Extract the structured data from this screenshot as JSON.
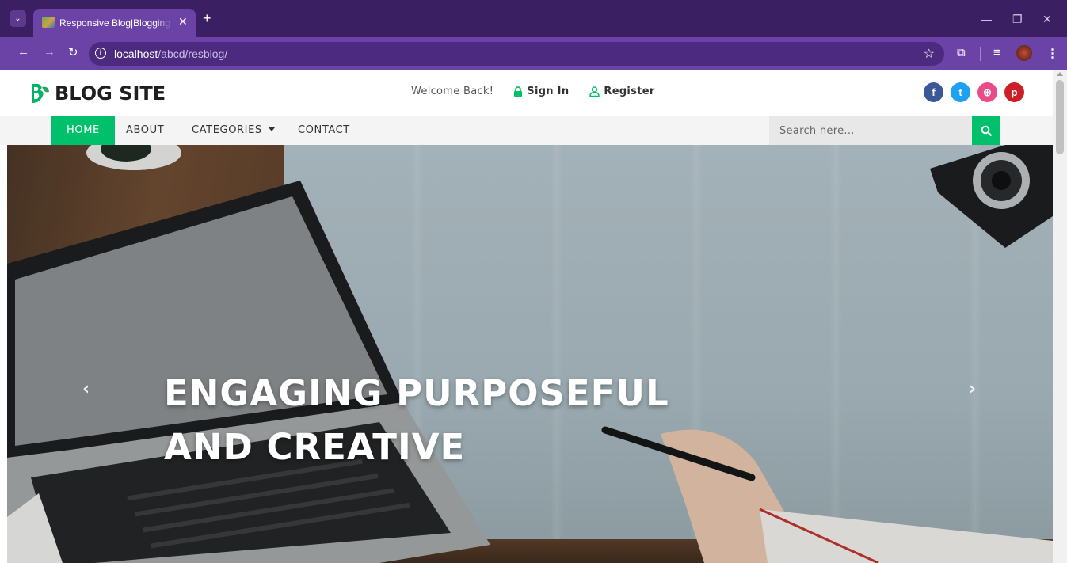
{
  "browser": {
    "tab_title": "Responsive Blog|Blogging For Beginners",
    "url_host": "localhost",
    "url_path": "/abcd/resblog/"
  },
  "header": {
    "logo_text": "BLOG SITE",
    "welcome": "Welcome Back!",
    "sign_in": "Sign In",
    "register": "Register",
    "socials": [
      {
        "name": "facebook-icon",
        "glyph": "f",
        "color": "#3b5998"
      },
      {
        "name": "twitter-icon",
        "glyph": "t",
        "color": "#1da1f2"
      },
      {
        "name": "dribbble-icon",
        "glyph": "⊛",
        "color": "#ea4c89"
      },
      {
        "name": "pinterest-icon",
        "glyph": "p",
        "color": "#cb2027"
      }
    ]
  },
  "menu": {
    "home": "HOME",
    "about": "ABOUT",
    "categories": "CATEGORIES",
    "contact": "CONTACT",
    "search_placeholder": "Search here..."
  },
  "hero": {
    "title_line1": "ENGAGING PURPOSEFUL",
    "title_line2": "AND CREATIVE",
    "prev": "‹",
    "next": "›"
  },
  "colors": {
    "accent": "#00c06b",
    "chrome_dark": "#3b1f63",
    "chrome_light": "#6b43a6"
  }
}
